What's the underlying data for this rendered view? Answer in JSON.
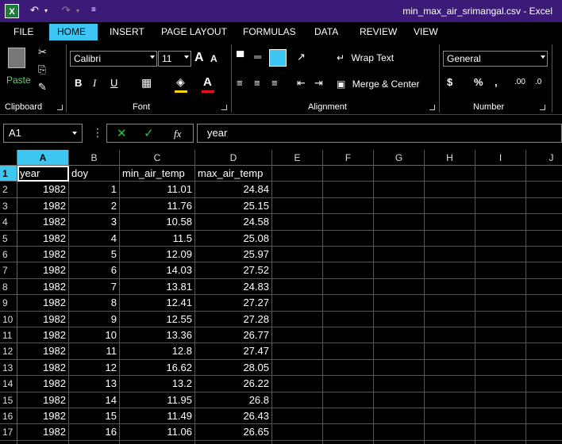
{
  "window": {
    "title": "min_max_air_srimangal.csv - Excel",
    "app_icon": "X"
  },
  "ribbon_tabs": [
    "FILE",
    "HOME",
    "INSERT",
    "PAGE LAYOUT",
    "FORMULAS",
    "DATA",
    "REVIEW",
    "VIEW"
  ],
  "active_tab": "HOME",
  "ribbon": {
    "clipboard": {
      "label": "Clipboard",
      "paste_label": "Paste"
    },
    "font": {
      "label": "Font",
      "font_name": "Calibri",
      "font_size": "11",
      "bold": "B",
      "italic": "I",
      "underline": "U"
    },
    "alignment": {
      "label": "Alignment",
      "wrap_text": "Wrap Text",
      "merge_center": "Merge & Center"
    },
    "number": {
      "label": "Number",
      "format": "General",
      "currency": "$",
      "percent": "%",
      "comma": ","
    }
  },
  "formula_bar": {
    "name_box": "A1",
    "value": "year",
    "fx_label": "fx"
  },
  "grid": {
    "columns": [
      "A",
      "B",
      "C",
      "D",
      "E",
      "F",
      "G",
      "H",
      "I",
      "J"
    ],
    "selected_column": "A",
    "selected_row": "1",
    "row_numbers": [
      "1",
      "2",
      "3",
      "4",
      "5",
      "6",
      "7",
      "8",
      "9",
      "10",
      "11",
      "12",
      "13",
      "14",
      "15",
      "16",
      "17",
      "18"
    ],
    "header_row": [
      "year",
      "doy",
      "min_air_temp",
      "max_air_temp"
    ],
    "rows": [
      [
        "1982",
        "1",
        "11.01",
        "24.84"
      ],
      [
        "1982",
        "2",
        "11.76",
        "25.15"
      ],
      [
        "1982",
        "3",
        "10.58",
        "24.58"
      ],
      [
        "1982",
        "4",
        "11.5",
        "25.08"
      ],
      [
        "1982",
        "5",
        "12.09",
        "25.97"
      ],
      [
        "1982",
        "6",
        "14.03",
        "27.52"
      ],
      [
        "1982",
        "7",
        "13.81",
        "24.83"
      ],
      [
        "1982",
        "8",
        "12.41",
        "27.27"
      ],
      [
        "1982",
        "9",
        "12.55",
        "27.28"
      ],
      [
        "1982",
        "10",
        "13.36",
        "26.77"
      ],
      [
        "1982",
        "11",
        "12.8",
        "27.47"
      ],
      [
        "1982",
        "12",
        "16.62",
        "28.05"
      ],
      [
        "1982",
        "13",
        "13.2",
        "26.22"
      ],
      [
        "1982",
        "14",
        "11.95",
        "26.8"
      ],
      [
        "1982",
        "15",
        "11.49",
        "26.43"
      ],
      [
        "1982",
        "16",
        "11.06",
        "26.65"
      ],
      [
        "1982",
        "17",
        "11.83",
        "25.97"
      ]
    ]
  }
}
